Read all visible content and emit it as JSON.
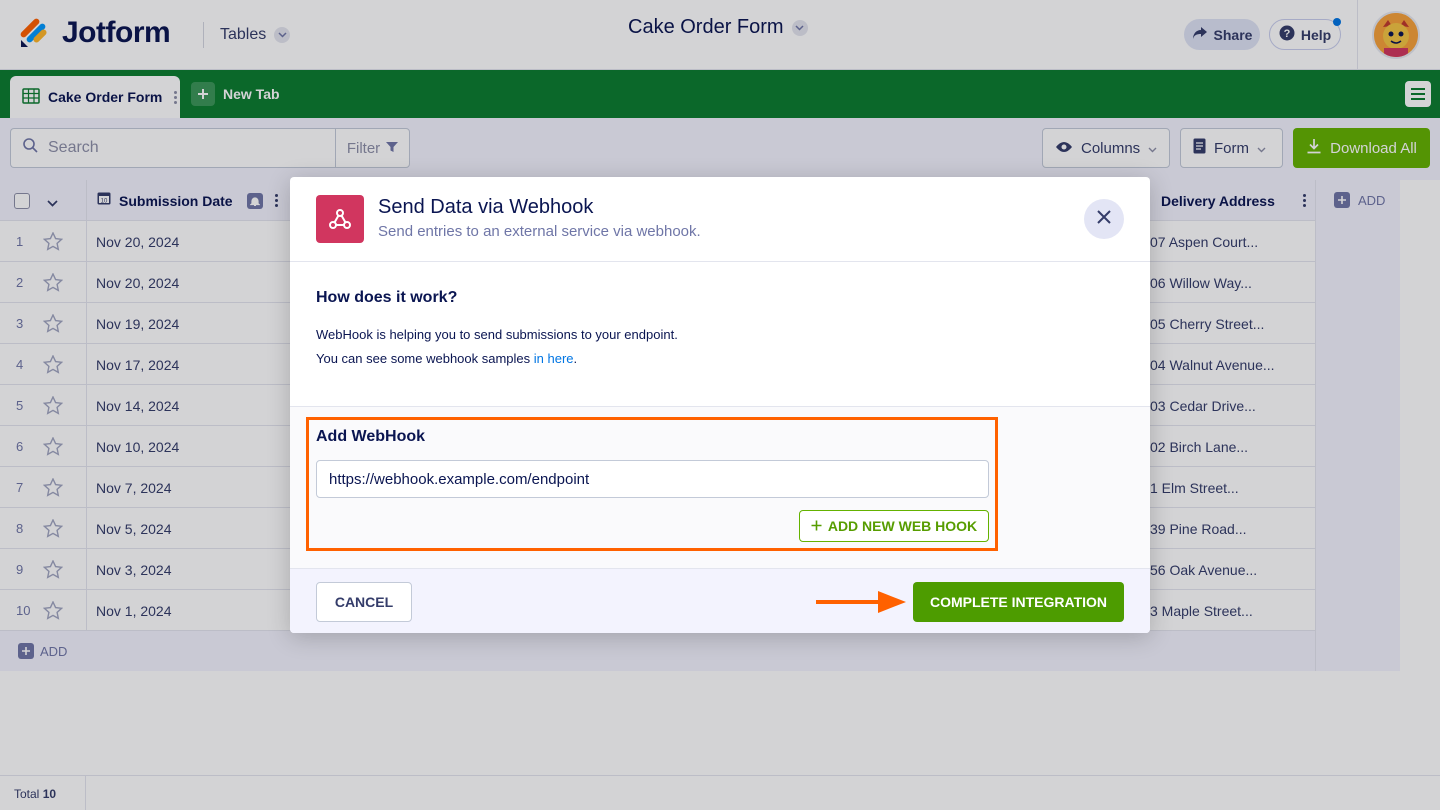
{
  "header": {
    "brand": "Jotform",
    "tables_label": "Tables",
    "form_title": "Cake Order Form",
    "share_label": "Share",
    "help_label": "Help"
  },
  "tabs": {
    "active_label": "Cake Order Form",
    "new_tab_label": "New Tab"
  },
  "toolbar": {
    "search_placeholder": "Search",
    "filter_label": "Filter",
    "columns_label": "Columns",
    "form_label": "Form",
    "download_label": "Download All"
  },
  "table": {
    "columns": [
      "Submission Date",
      "Delivery Address"
    ],
    "add_column_label": "ADD",
    "add_row_label": "ADD",
    "rows": [
      {
        "num": "1",
        "date": "Nov 20, 2024",
        "address": "07 Aspen Court..."
      },
      {
        "num": "2",
        "date": "Nov 20, 2024",
        "address": "06 Willow Way..."
      },
      {
        "num": "3",
        "date": "Nov 19, 2024",
        "address": "05 Cherry Street..."
      },
      {
        "num": "4",
        "date": "Nov 17, 2024",
        "address": "04 Walnut Avenue..."
      },
      {
        "num": "5",
        "date": "Nov 14, 2024",
        "address": "03 Cedar Drive..."
      },
      {
        "num": "6",
        "date": "Nov 10, 2024",
        "address": "02 Birch Lane..."
      },
      {
        "num": "7",
        "date": "Nov 7, 2024",
        "address": "1 Elm Street..."
      },
      {
        "num": "8",
        "date": "Nov 5, 2024",
        "address": "39 Pine Road..."
      },
      {
        "num": "9",
        "date": "Nov 3, 2024",
        "address": "56 Oak Avenue..."
      },
      {
        "num": "10",
        "date": "Nov 1, 2024",
        "address": "3 Maple Street..."
      }
    ],
    "total_label": "Total",
    "total_value": "10"
  },
  "modal": {
    "title": "Send Data via Webhook",
    "subtitle": "Send entries to an external service via webhook.",
    "how_title": "How does it work?",
    "how_line1": "WebHook is helping you to send submissions to your endpoint.",
    "how_line2_prefix": "You can see some webhook samples ",
    "how_line2_link": "in here",
    "how_line2_suffix": ".",
    "add_title": "Add WebHook",
    "url_value": "https://webhook.example.com/endpoint",
    "add_new_label": "ADD NEW WEB HOOK",
    "cancel_label": "CANCEL",
    "complete_label": "COMPLETE INTEGRATION"
  },
  "colors": {
    "brand_green": "#0b7d2f",
    "accent_green": "#4d9c00",
    "highlight_orange": "#ff6100",
    "webhook_icon_bg": "#d1365f"
  },
  "icons": [
    "jotform-logo-icon",
    "chevron-down-icon",
    "share-icon",
    "help-icon",
    "grid-table-icon",
    "plus-icon",
    "hamburger-menu-icon",
    "search-icon",
    "filter-funnel-icon",
    "eye-icon",
    "form-doc-icon",
    "download-icon",
    "calendar-icon",
    "bell-icon",
    "star-icon",
    "webhook-icon",
    "close-icon",
    "arrow-right-icon"
  ]
}
